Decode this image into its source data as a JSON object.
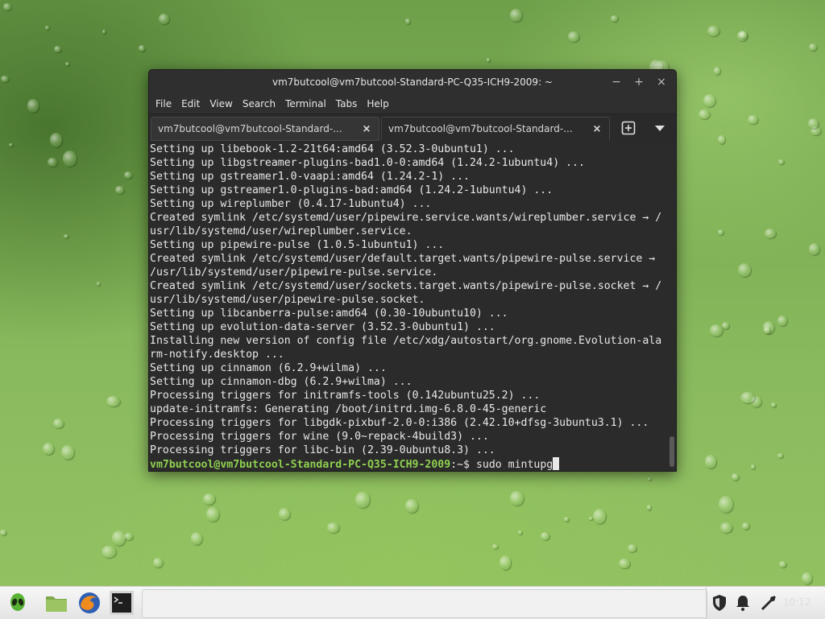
{
  "window": {
    "title": "vm7butcool@vm7butcool-Standard-PC-Q35-ICH9-2009: ~",
    "controls": {
      "minimize": "−",
      "maximize": "+",
      "close": "×"
    }
  },
  "menu": [
    "File",
    "Edit",
    "View",
    "Search",
    "Terminal",
    "Tabs",
    "Help"
  ],
  "tabs": [
    {
      "label": "vm7butcool@vm7butcool-Standard-...",
      "close": "×"
    },
    {
      "label": "vm7butcool@vm7butcool-Standard-...",
      "close": "×"
    }
  ],
  "terminal": {
    "lines": [
      "Setting up libebook-1.2-21t64:amd64 (3.52.3-0ubuntu1) ...",
      "Setting up libgstreamer-plugins-bad1.0-0:amd64 (1.24.2-1ubuntu4) ...",
      "Setting up gstreamer1.0-vaapi:amd64 (1.24.2-1) ...",
      "Setting up gstreamer1.0-plugins-bad:amd64 (1.24.2-1ubuntu4) ...",
      "Setting up wireplumber (0.4.17-1ubuntu4) ...",
      "Created symlink /etc/systemd/user/pipewire.service.wants/wireplumber.service → /",
      "usr/lib/systemd/user/wireplumber.service.",
      "Setting up pipewire-pulse (1.0.5-1ubuntu1) ...",
      "Created symlink /etc/systemd/user/default.target.wants/pipewire-pulse.service →",
      "/usr/lib/systemd/user/pipewire-pulse.service.",
      "Created symlink /etc/systemd/user/sockets.target.wants/pipewire-pulse.socket → /",
      "usr/lib/systemd/user/pipewire-pulse.socket.",
      "Setting up libcanberra-pulse:amd64 (0.30-10ubuntu10) ...",
      "Setting up evolution-data-server (3.52.3-0ubuntu1) ...",
      "Installing new version of config file /etc/xdg/autostart/org.gnome.Evolution-ala",
      "rm-notify.desktop ...",
      "Setting up cinnamon (6.2.9+wilma) ...",
      "Setting up cinnamon-dbg (6.2.9+wilma) ...",
      "Processing triggers for initramfs-tools (0.142ubuntu25.2) ...",
      "update-initramfs: Generating /boot/initrd.img-6.8.0-45-generic",
      "Processing triggers for libgdk-pixbuf-2.0-0:i386 (2.42.10+dfsg-3ubuntu3.1) ...",
      "Processing triggers for wine (9.0~repack-4build3) ...",
      "Processing triggers for libc-bin (2.39-0ubuntu8.3) ..."
    ],
    "prompt": "vm7butcool@vm7butcool-Standard-PC-Q35-ICH9-2009",
    "prompt_suffix": ":~$ ",
    "command": "sudo mintupg"
  },
  "panel": {
    "launchers": [
      "alien-menu-icon",
      "folder-icon",
      "firefox-icon",
      "terminal-icon"
    ],
    "tray": [
      "shield-icon",
      "notifications-icon",
      "network-icon"
    ],
    "clock": "10:12"
  },
  "colors": {
    "prompt": "#8fd14f",
    "terminal_bg": "#2b2b2b",
    "titlebar": "#2f2f2f"
  }
}
